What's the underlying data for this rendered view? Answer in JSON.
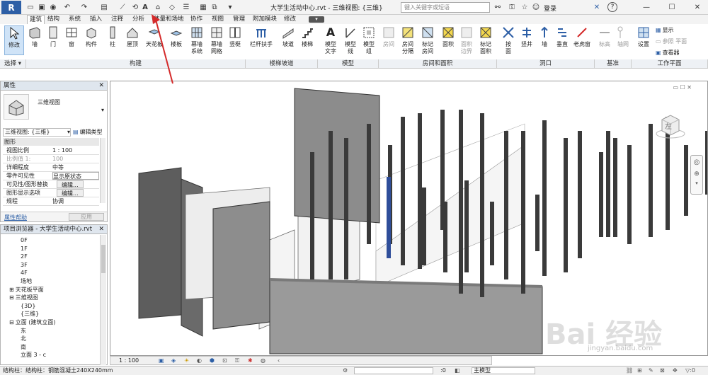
{
  "titlebar": {
    "title": "大学生活动中心.rvt - 三维视图: {三维}",
    "search_placeholder": "键入关键字或短语",
    "login": "登录",
    "help": "?"
  },
  "tabs": [
    "建筑",
    "结构",
    "系统",
    "插入",
    "注释",
    "分析",
    "体量和场地",
    "协作",
    "视图",
    "管理",
    "附加模块",
    "修改"
  ],
  "active_tab": "建筑",
  "ribbon": {
    "modify": "修改",
    "select": "选择",
    "build": [
      {
        "label": "墙"
      },
      {
        "label": "门"
      },
      {
        "label": "窗"
      },
      {
        "label": "构件"
      },
      {
        "label": "柱"
      },
      {
        "label": "屋顶"
      },
      {
        "label": "天花板"
      },
      {
        "label": "楼板"
      },
      {
        "label": "幕墙\n系统"
      },
      {
        "label": "幕墙\n网格"
      },
      {
        "label": "竖梃"
      }
    ],
    "stairs": [
      {
        "label": "栏杆扶手"
      },
      {
        "label": "坡道"
      },
      {
        "label": "楼梯"
      }
    ],
    "model": [
      {
        "label": "模型\n文字"
      },
      {
        "label": "模型\n线"
      },
      {
        "label": "模型\n组"
      }
    ],
    "room": [
      {
        "label": "房间"
      },
      {
        "label": "房间\n分隔"
      },
      {
        "label": "标记\n房间"
      },
      {
        "label": "面积"
      },
      {
        "label": "面积\n边界"
      },
      {
        "label": "标记\n面积"
      }
    ],
    "opening": [
      {
        "label": "按\n面"
      },
      {
        "label": "竖井"
      },
      {
        "label": "墙"
      },
      {
        "label": "垂直"
      },
      {
        "label": "老虎窗"
      }
    ],
    "datum": [
      {
        "label": "标高"
      },
      {
        "label": "轴网"
      }
    ],
    "workplane": {
      "set": "设置",
      "show": "显示",
      "ref": "参照 平面",
      "viewer": "查看器"
    },
    "groups": [
      "选择",
      "构建",
      "楼梯坡道",
      "模型",
      "房间和面积",
      "洞口",
      "基准",
      "工作平面"
    ]
  },
  "properties": {
    "title": "属性",
    "type_name": "三维视图",
    "view_selector": "三维视图: {三维}",
    "edit_type": "编辑类型",
    "section": "图形",
    "rows": [
      {
        "k": "视图比例",
        "v": "1 : 100"
      },
      {
        "k": "比例值 1:",
        "v": "100"
      },
      {
        "k": "详细程度",
        "v": "中等"
      },
      {
        "k": "零件可见性",
        "v": "显示原状态"
      },
      {
        "k": "可见性/图形替换",
        "v": "编辑..."
      },
      {
        "k": "图形显示选项",
        "v": "编辑..."
      },
      {
        "k": "规程",
        "v": "协调"
      }
    ],
    "help": "属性帮助",
    "apply": "应用"
  },
  "browser": {
    "title": "项目浏览器 - 大学生活动中心.rvt",
    "items": [
      {
        "t": "0F",
        "l": 3
      },
      {
        "t": "1F",
        "l": 3
      },
      {
        "t": "2F",
        "l": 3
      },
      {
        "t": "3F",
        "l": 3
      },
      {
        "t": "4F",
        "l": 3
      },
      {
        "t": "场地",
        "l": 3
      },
      {
        "t": "天花板平面",
        "l": 1,
        "s": "⊞"
      },
      {
        "t": "三维视图",
        "l": 1,
        "s": "⊟"
      },
      {
        "t": "{3D}",
        "l": 3
      },
      {
        "t": "{三维}",
        "l": 3
      },
      {
        "t": "立面 (建筑立面)",
        "l": 1,
        "s": "⊟"
      },
      {
        "t": "东",
        "l": 3
      },
      {
        "t": "北",
        "l": 3
      },
      {
        "t": "南",
        "l": 3
      },
      {
        "t": "立面 3 - c",
        "l": 3
      }
    ]
  },
  "viewport": {
    "scale": "1 : 100",
    "cube_face": "左"
  },
  "status": {
    "text": "结构柱：结构柱：钢筋混凝土240X240mm",
    "model": "主模型",
    "zero": ":0"
  },
  "watermark": {
    "logo": "Bai 经验",
    "url": "jingyan.baidu.com"
  },
  "colors": {
    "accent": "#2d5fa6",
    "wall_dark": "#5d5d5d",
    "column": "#3a3a3a",
    "highlight": "#2f4e9a",
    "arrow": "#d42a2a"
  }
}
